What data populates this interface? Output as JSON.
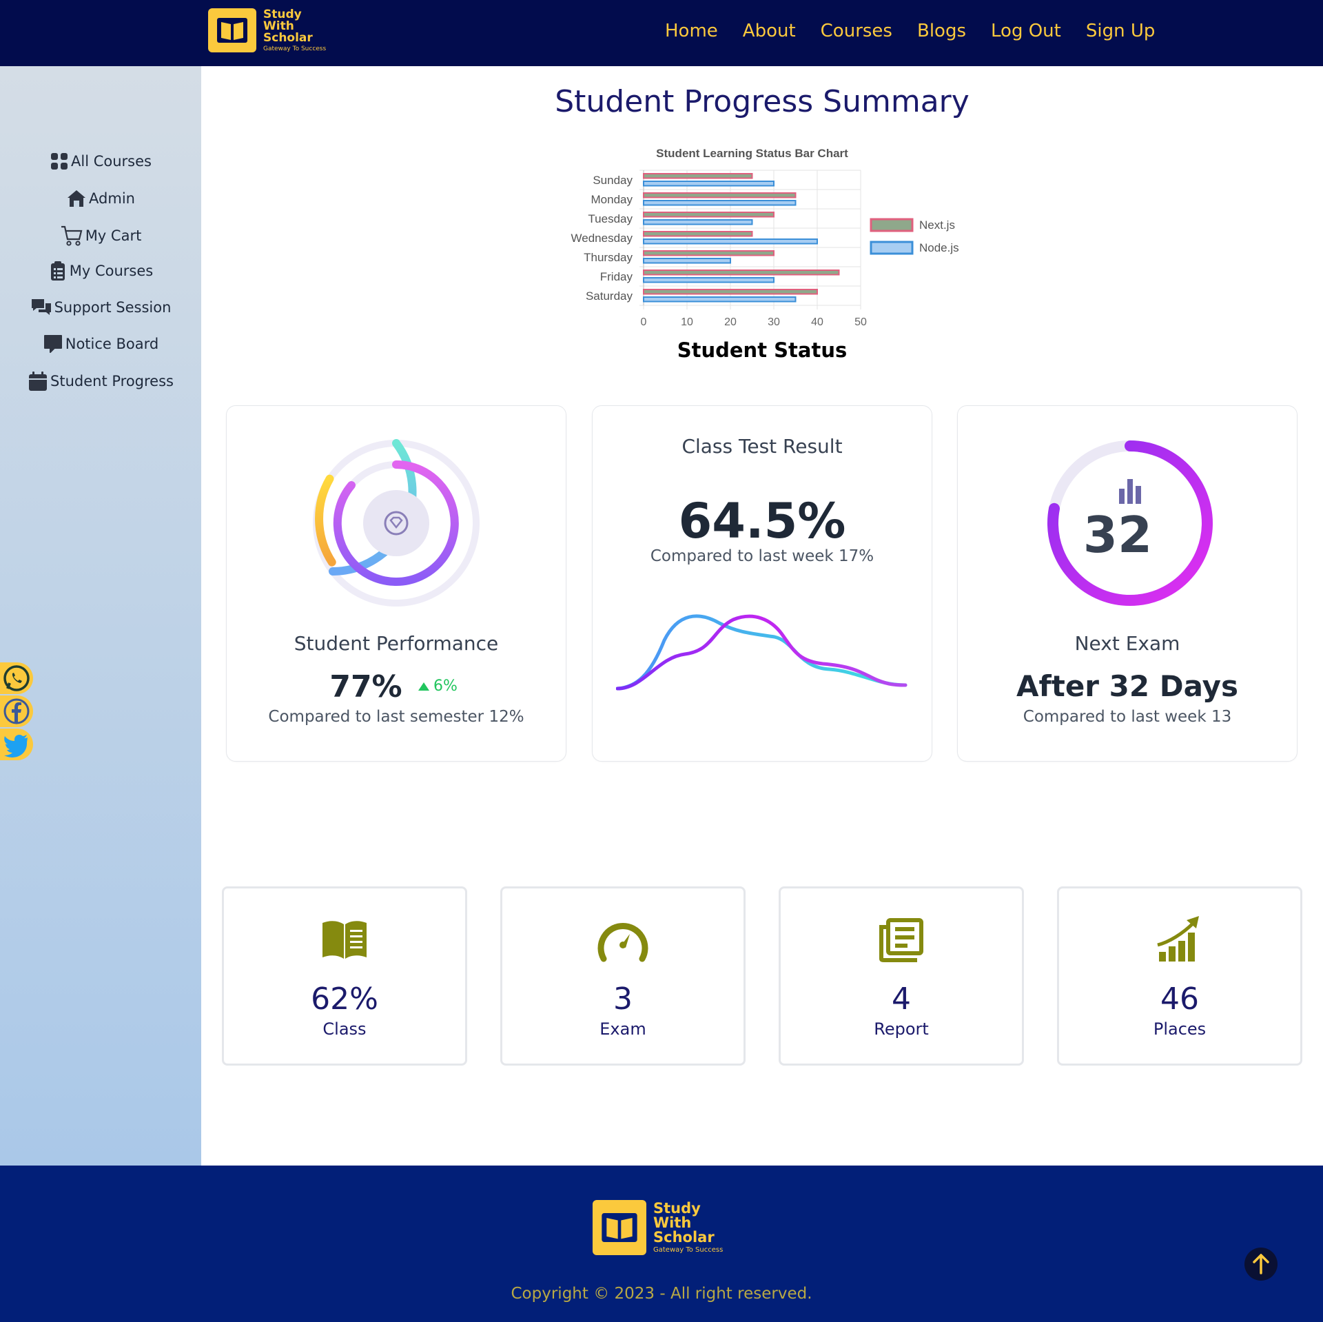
{
  "brand": {
    "name_line1": "Study",
    "name_line2": "With",
    "name_line3": "Scholar",
    "tagline": "Gateway To Success"
  },
  "nav": {
    "items": [
      {
        "label": "Home"
      },
      {
        "label": "About"
      },
      {
        "label": "Courses"
      },
      {
        "label": "Blogs"
      },
      {
        "label": "Log Out"
      },
      {
        "label": "Sign Up"
      }
    ]
  },
  "sidebar": {
    "items": [
      {
        "label": "All Courses",
        "icon": "grid-icon"
      },
      {
        "label": "Admin",
        "icon": "home-icon"
      },
      {
        "label": "My Cart",
        "icon": "cart-icon"
      },
      {
        "label": "My Courses",
        "icon": "clipboard-icon"
      },
      {
        "label": "Support Session",
        "icon": "chat-icon"
      },
      {
        "label": "Notice Board",
        "icon": "message-icon"
      },
      {
        "label": "Student Progress",
        "icon": "calendar-icon"
      }
    ],
    "social": [
      "whatsapp-icon",
      "facebook-icon",
      "twitter-icon"
    ]
  },
  "page": {
    "title": "Student Progress Summary",
    "chart_caption": "Student Status"
  },
  "chart_data": {
    "type": "bar",
    "orientation": "horizontal",
    "title": "Student Learning Status Bar Chart",
    "categories": [
      "Sunday",
      "Monday",
      "Tuesday",
      "Wednesday",
      "Thursday",
      "Friday",
      "Saturday"
    ],
    "series": [
      {
        "name": "Next.js",
        "values": [
          25,
          35,
          30,
          25,
          30,
          45,
          40
        ],
        "fill": "#8fa88b",
        "stroke": "#e0607e"
      },
      {
        "name": "Node.js",
        "values": [
          30,
          35,
          25,
          40,
          20,
          30,
          35
        ],
        "fill": "#a7cdf2",
        "stroke": "#3b8fd8"
      }
    ],
    "xlim": [
      0,
      50
    ],
    "xticks": [
      "0",
      "10",
      "20",
      "30",
      "40",
      "50"
    ],
    "grid": true,
    "legend": "right"
  },
  "cards": {
    "performance": {
      "label": "Student Performance",
      "value": "77%",
      "delta": "6%",
      "compare": "Compared to last semester 12%",
      "icon": "diamond-icon"
    },
    "test": {
      "label": "Class Test Result",
      "value": "64.5%",
      "compare": "Compared to last week 17%"
    },
    "exam": {
      "number": "32",
      "label": "Next Exam",
      "value": "After 32 Days",
      "compare": "Compared to last week 13",
      "progress": 0.78
    }
  },
  "stats": [
    {
      "value": "62%",
      "label": "Class",
      "icon": "book-icon"
    },
    {
      "value": "3",
      "label": "Exam",
      "icon": "speedometer-icon"
    },
    {
      "value": "4",
      "label": "Report",
      "icon": "newspaper-icon"
    },
    {
      "value": "46",
      "label": "Places",
      "icon": "growth-chart-icon"
    }
  ],
  "footer": {
    "copyright": "Copyright © 2023 - All right reserved."
  },
  "colors": {
    "navy": "#020c4d",
    "footer": "#021f78",
    "accent": "#fbc93d",
    "title": "#1b1a6b",
    "olive": "#858a0f",
    "positive": "#22c55e"
  }
}
